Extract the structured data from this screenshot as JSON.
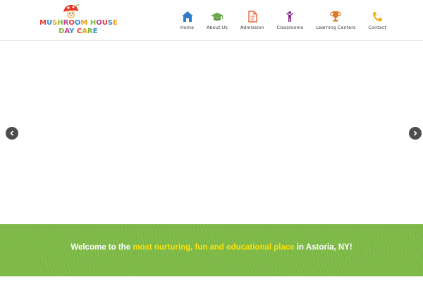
{
  "logo": {
    "line1": [
      "M",
      "U",
      "S",
      "H",
      "R",
      "O",
      "O",
      "M",
      " ",
      "H",
      "O",
      "U",
      "S",
      "E"
    ],
    "line2": [
      "D",
      "A",
      "Y",
      " ",
      "C",
      "A",
      "R",
      "E"
    ],
    "letter_colors_1": [
      "#e63b2e",
      "#2d8fd6",
      "#f2a21a",
      "#7ab93f",
      "#c03f8e",
      "#e63b2e",
      "#2d8fd6",
      "#f2a21a",
      "#ffffff",
      "#7ab93f",
      "#c03f8e",
      "#e63b2e",
      "#2d8fd6",
      "#f2a21a"
    ],
    "letter_colors_2": [
      "#7ab93f",
      "#c03f8e",
      "#2d8fd6",
      "#ffffff",
      "#e63b2e",
      "#f2a21a",
      "#7ab93f",
      "#2d8fd6"
    ]
  },
  "nav": {
    "items": [
      {
        "label": "Home",
        "icon": "home-icon",
        "color": "#2f7fc8"
      },
      {
        "label": "About Us",
        "icon": "graduation-cap-icon",
        "color": "#6aa84f"
      },
      {
        "label": "Admission",
        "icon": "document-icon",
        "color": "#e8663d"
      },
      {
        "label": "Classrooms",
        "icon": "person-icon",
        "color": "#8a2c8a"
      },
      {
        "label": "Learning Centers",
        "icon": "trophy-icon",
        "color": "#e07b27"
      },
      {
        "label": "Contact",
        "icon": "phone-icon",
        "color": "#f2b51c"
      }
    ]
  },
  "slider": {
    "prev_icon": "chevron-left-icon",
    "next_icon": "chevron-right-icon"
  },
  "banner": {
    "text_before": "Welcome to the ",
    "text_highlight": "most nurturing, fun and educational place",
    "text_after": " in Astoria, NY!",
    "background_color": "#7eba47",
    "highlight_color": "#f6e10f"
  }
}
